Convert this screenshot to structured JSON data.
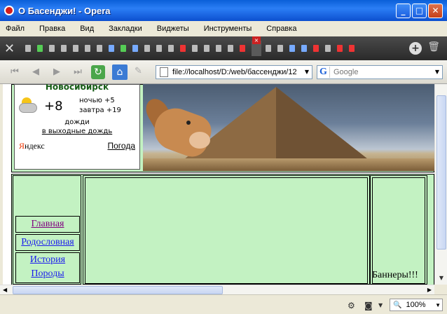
{
  "window": {
    "title": "О Басенджи! - Opera"
  },
  "menu": [
    "Файл",
    "Правка",
    "Вид",
    "Закладки",
    "Виджеты",
    "Инструменты",
    "Справка"
  ],
  "address": {
    "url": "file://localhost/D:/web/бассенджи/12"
  },
  "search": {
    "engine": "Google",
    "placeholder": "Google"
  },
  "weather": {
    "city": "Новосибирск",
    "temp": "+8",
    "night": "ночью +5",
    "tomorrow": "завтра +19",
    "condition": "дожди",
    "weekend": "в выходные дождь",
    "brand_ya": "Я",
    "brand_rest": "ндекс",
    "link": "Погода"
  },
  "nav": {
    "home": "Главная",
    "pedigree": "Родословная",
    "history_line1": "История",
    "history_line2": "Породы"
  },
  "banners": "Баннеры!!!",
  "status": {
    "zoom": "100%"
  },
  "colors": {
    "page_bg": "#c3f2c2",
    "visited_link": "#800080",
    "link": "#1a1aee"
  }
}
